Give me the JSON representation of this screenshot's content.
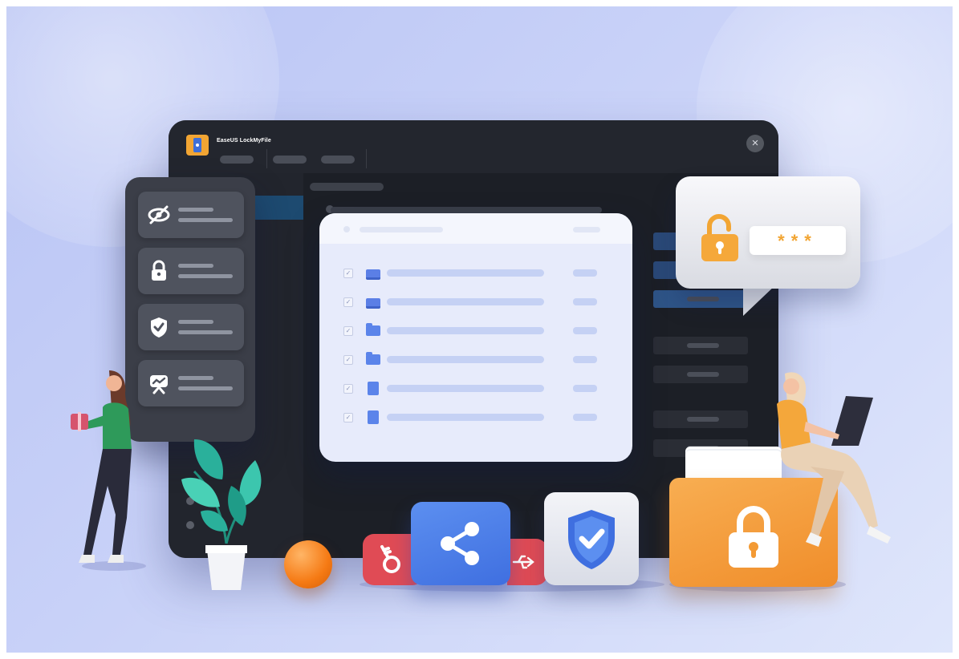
{
  "app": {
    "title": "EaseUS LockMyFile",
    "close_glyph": "×"
  },
  "file_list": {
    "rows": [
      {
        "icon": "drive-icon",
        "checked": true
      },
      {
        "icon": "drive-icon",
        "checked": true
      },
      {
        "icon": "folder-icon",
        "checked": true
      },
      {
        "icon": "folder-icon",
        "checked": true
      },
      {
        "icon": "document-icon",
        "checked": true
      },
      {
        "icon": "document-icon",
        "checked": true
      }
    ],
    "check_glyph": "✓"
  },
  "features": [
    {
      "icon": "hide-eye-icon",
      "glyph": "⊘"
    },
    {
      "icon": "lock-icon",
      "glyph": "🔒"
    },
    {
      "icon": "shield-check-icon",
      "glyph": "⛨"
    },
    {
      "icon": "monitor-icon",
      "glyph": "⌂"
    }
  ],
  "password_bubble": {
    "masked_password": "***",
    "icon": "unlocked-padlock-icon"
  },
  "tiles": [
    {
      "icon": "key-icon",
      "color": "#e04b55"
    },
    {
      "icon": "share-icon",
      "color": "#4a7fe6"
    },
    {
      "icon": "usb-icon",
      "color": "#e04b55"
    },
    {
      "icon": "shield-check-icon",
      "color": "#e9ebf2"
    },
    {
      "icon": "locked-folder-icon",
      "color": "#f5a03c"
    }
  ],
  "colors": {
    "accent_blue": "#4a7fe6",
    "accent_orange": "#f5a03c",
    "window_dark": "#1c1f26",
    "background": "#c9d2f8"
  }
}
